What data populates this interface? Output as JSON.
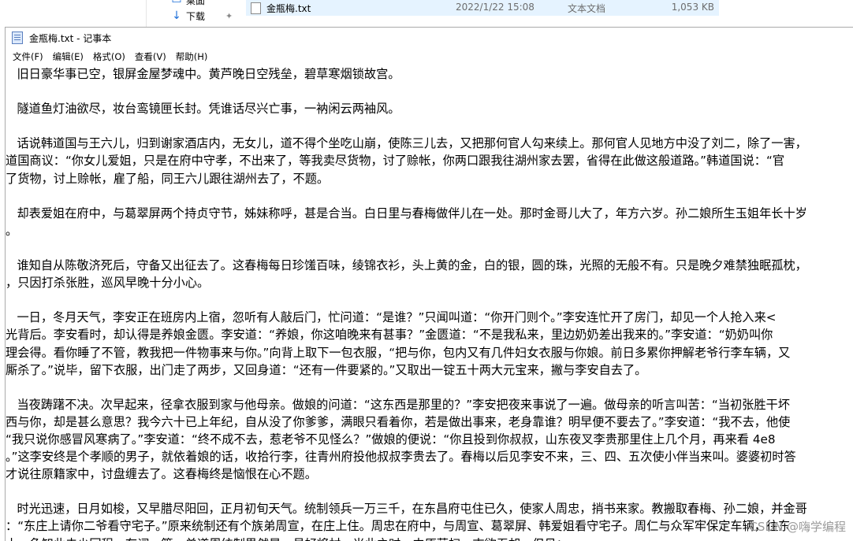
{
  "explorer": {
    "partial_item_label": "桌面",
    "download_label": "下载",
    "file": {
      "name": "金瓶梅.txt",
      "modified": "2022/1/22 15:08",
      "type": "文本文档",
      "size": "1,053 KB"
    }
  },
  "window": {
    "title": "金瓶梅.txt - 记事本"
  },
  "menu": [
    "文件(F)",
    "编辑(E)",
    "格式(O)",
    "查看(V)",
    "帮助(H)"
  ],
  "document_lines": [
    "   旧日豪华事已空，银屏金屋梦魂中。黄芦晚日空残垒，碧草寒烟锁故宫。",
    "",
    "   隧道鱼灯油欲尽，妆台鸾镜匣长封。凭谁话尽兴亡事，一衲闲云两袖风。",
    "",
    "   话说韩道国与王六儿，归到谢家酒店内，无女儿，道不得个坐吃山崩，使陈三儿去，又把那何官人勾来续上。那何官人见地方中没了刘二，除了一害，",
    "道国商议：“你女儿爱姐，只是在府中守孝，不出来了，等我卖尽货物，讨了赊帐，你两口跟我往湖州家去罢，省得在此做这般道路。”韩道国说：“官",
    "了货物，讨上赊帐，雇了船，同王六儿跟往湖州去了，不题。",
    "",
    "   却表爱姐在府中，与葛翠屏两个持贞守节，姊妹称呼，甚是合当。白日里与春梅做伴儿在一处。那时金哥儿大了，年方六岁。孙二娘所生玉姐年长十岁",
    "。",
    "",
    "   谁知自从陈敬济死后，守备又出征去了。这春梅每日珍馐百味，绫锦衣衫，头上黄的金，白的银，圆的珠，光照的无般不有。只是晚夕难禁独眠孤枕，",
    "，只因打杀张胜，巡风早晚十分小心。",
    "",
    "   一日，冬月天气，李安正在班房内上宿，忽听有人敲后门，忙问道：“是谁？”只闻叫道：“你开门则个。”李安连忙开了房门，却见一个人抢入来<",
    "光背后。李安看时，却认得是养娘金匮。李安道：“养娘，你这咱晚来有甚事？”金匮道：“不是我私来，里边奶奶差出我来的。”李安道：“奶奶叫你",
    "理会得。看你睡了不管，教我把一件物事来与你。”向背上取下一包衣服，“把与你，包内又有几件妇女衣服与你娘。前日多累你押解老爷行李车辆，又",
    "厮杀了。”说毕，留下衣服，出门走了两步，又回身道：“还有一件要紧的。”又取出一锭五十两大元宝来，撇与李安自去了。",
    "",
    "   当夜踌躇不决。次早起来，径拿衣服到家与他母亲。做娘的问道：“这东西是那里的？”李安把夜来事说了一遍。做母亲的听言叫苦：“当初张胜干坏",
    "西与你，却是甚么意思？我今六十已上年纪，自从没了你爹爹，满眼只看着你，若是做出事来，老身靠谁？明早便不要去了。”李安道：“我不去，他使",
    "“我只说你感冒风寒病了。”李安道：“终不成不去，惹老爷不见怪么？”做娘的便说：“你且投到你叔叔，山东夜叉李贵那里住上几个月，再来看 4e8",
    "。”这李安终是个孝顺的男子，就依着娘的话，收拾行李，往青州府投他叔叔李贵去了。春梅以后见李安不来，三、四、五次使小伴当来叫。婆婆初时答",
    "才说往原籍家中，讨盘缠去了。这春梅终是恼恨在心不题。",
    "",
    "   时光迅速，日月如梭，又早腊尽阳回，正月初旬天气。统制领兵一万三千，在东昌府屯住已久，使家人周忠，捎书来家。教搬取春梅、孙二娘，并金哥",
    "：“东庄上请你二爷看守宅子。”原来统制还有个族弟周宣，在庄上住。周忠在府中，与周宣、葛翠屏、韩爱姐看守宅子。周仁与众军牢保定车辆，往东",
    "土，争知此去少回程。有词一篇，单道周统制果然是一员好将材。当此之时，中原荡扫，志欲吞胡。但见："
  ],
  "watermark": "CSDN @嗨学编程"
}
